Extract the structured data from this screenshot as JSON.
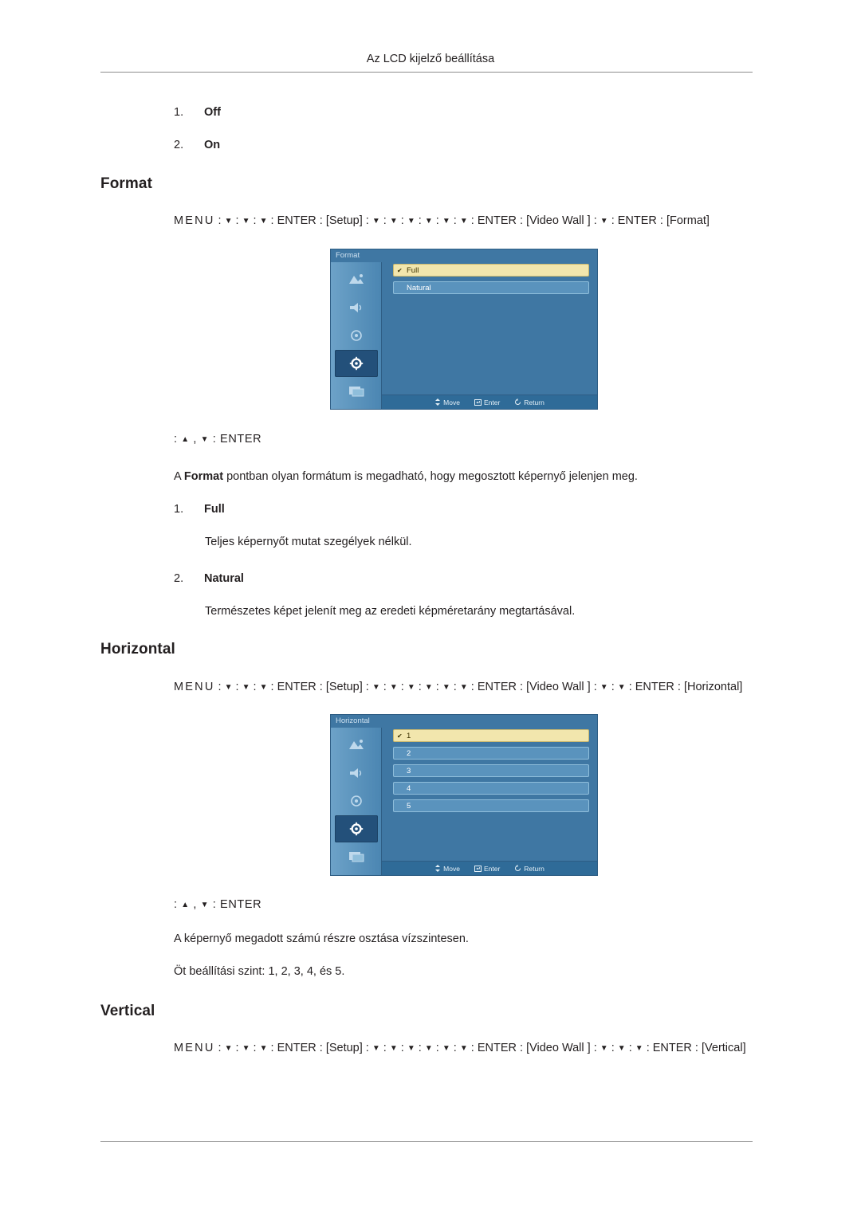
{
  "header": {
    "title": "Az LCD kijelző beállítása"
  },
  "top_list": {
    "items": [
      {
        "index": "1.",
        "label": "Off"
      },
      {
        "index": "2.",
        "label": "On"
      }
    ]
  },
  "sections": [
    {
      "heading": "Format",
      "path_line1_pre": "MENU",
      "path": "MENU : ▼ : ▼ : ▼ : ENTER : [Setup] : ▼ : ▼ : ▼ : ▼ : ▼ : ▼ : ENTER : [Video Wall ] : ▼ : ENTER : [Format]",
      "enter_line": ": ▲ , ▼ : ENTER",
      "description": "A Format pontban olyan formátum is megadható, hogy megosztott képernyő jelenjen meg.",
      "description_bold_word": "Format",
      "osd": {
        "title": "Format",
        "rows": [
          {
            "label": "Full",
            "active": true,
            "tick": "✔"
          },
          {
            "label": "Natural",
            "active": false,
            "tick": ""
          }
        ],
        "footer": {
          "move": "Move",
          "enter": "Enter",
          "return": "Return"
        }
      },
      "options": [
        {
          "index": "1.",
          "label": "Full",
          "desc": "Teljes képernyőt mutat szegélyek nélkül."
        },
        {
          "index": "2.",
          "label": "Natural",
          "desc": "Természetes képet jelenít meg az eredeti képméretarány megtartásával."
        }
      ]
    },
    {
      "heading": "Horizontal",
      "path": "MENU : ▼ : ▼ : ▼ : ENTER : [Setup] : ▼ : ▼ : ▼ : ▼ : ▼ : ▼ : ENTER : [Video Wall ] : ▼ : ▼ : ENTER : [Horizontal]",
      "enter_line": ": ▲ , ▼ : ENTER",
      "osd": {
        "title": "Horizontal",
        "rows": [
          {
            "label": "1",
            "active": true,
            "tick": "✔"
          },
          {
            "label": "2",
            "active": false,
            "tick": ""
          },
          {
            "label": "3",
            "active": false,
            "tick": ""
          },
          {
            "label": "4",
            "active": false,
            "tick": ""
          },
          {
            "label": "5",
            "active": false,
            "tick": ""
          }
        ],
        "footer": {
          "move": "Move",
          "enter": "Enter",
          "return": "Return"
        }
      },
      "paragraphs": [
        "A képernyő megadott számú részre osztása vízszintesen.",
        "Öt beállítási szint: 1, 2, 3, 4, és 5."
      ]
    },
    {
      "heading": "Vertical",
      "path": "MENU : ▼ : ▼ : ▼ : ENTER : [Setup] : ▼ : ▼ : ▼ : ▼ : ▼ : ▼ : ENTER : [Video Wall ] : ▼ : ▼ : ▼ : ENTER : [Vertical]"
    }
  ],
  "colors": {
    "osd_bg": "#3f77a3",
    "osd_highlight": "#f2e6ad",
    "osd_row": "#5a93bd",
    "text": "#231f20"
  }
}
